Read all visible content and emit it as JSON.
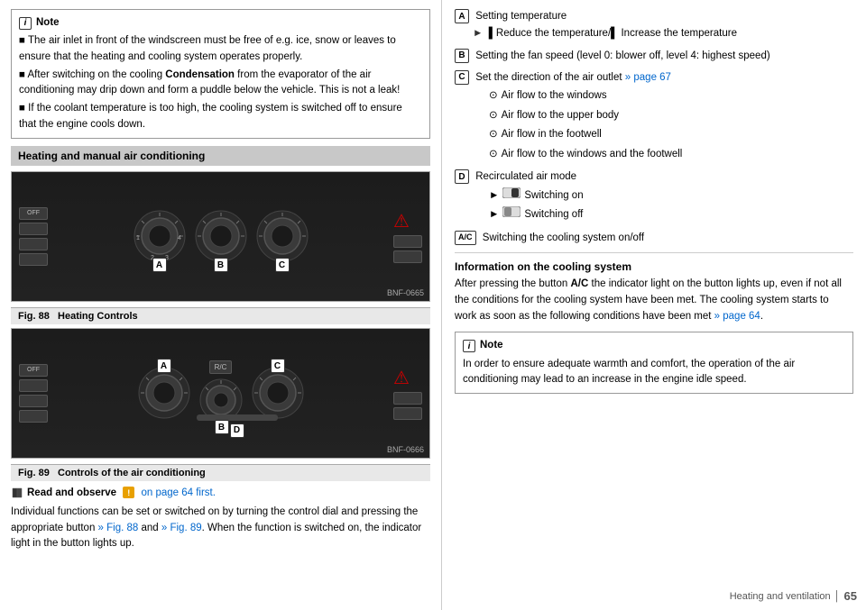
{
  "left_column": {
    "note_box": {
      "icon": "i",
      "title": "Note",
      "items": [
        "The air inlet in front of the windscreen must be free of e.g. ice, snow or leaves to ensure that the heating and cooling system operates properly.",
        "After switching on the cooling Condensation from the evaporator of the air conditioning may drip down and form a puddle below the vehicle. This is not a leak!",
        "If the coolant temperature is too high, the cooling system is switched off to ensure that the engine cools down."
      ]
    },
    "section_heading": "Heating and manual air conditioning",
    "fig88": {
      "bnf": "BNF-0665",
      "caption_prefix": "Fig. 88",
      "caption": "Heating Controls"
    },
    "fig89": {
      "bnf": "BNF-0666",
      "caption_prefix": "Fig. 89",
      "caption": "Controls of the air conditioning"
    },
    "read_observe": {
      "icon": "!",
      "text": "Read and observe",
      "link": "on page 64 first."
    },
    "body_text": "Individual functions can be set or switched on by turning the control dial and pressing the appropriate button » Fig. 88 and » Fig. 89. When the function is switched on, the indicator light in the button lights up."
  },
  "right_column": {
    "items": [
      {
        "badge": "A",
        "label": "Setting temperature",
        "sub_items": [
          "◄ ▌Reduce the temperature/▌ Increase the temperature"
        ]
      },
      {
        "badge": "B",
        "label": "Setting the fan speed (level 0: blower off, level 4: highest speed)"
      },
      {
        "badge": "C",
        "label": "Set the direction of the air outlet",
        "link": "» page 67",
        "sub_items": [
          "Air flow to the windows",
          "Air flow to the upper body",
          "Air flow in the footwell",
          "Air flow to the windows and the footwell"
        ]
      },
      {
        "badge": "D",
        "label": "Recirculated air mode",
        "sub_items": [
          "Switching on",
          "Switching off"
        ]
      },
      {
        "badge": "A/C",
        "label": "Switching the cooling system on/off"
      }
    ],
    "info_section": {
      "heading": "Information on the cooling system",
      "text": "After pressing the button A/C the indicator light on the button lights up, even if not all the conditions for the cooling system have been met. The cooling system starts to work as soon as the following conditions have been met",
      "link": "» page 64",
      "link_end": "."
    },
    "note_box": {
      "icon": "i",
      "title": "Note",
      "text": "In order to ensure adequate warmth and comfort, the operation of the air conditioning may lead to an increase in the engine idle speed."
    },
    "footer": {
      "label": "Heating and ventilation",
      "separator": "│",
      "page": "65"
    }
  }
}
